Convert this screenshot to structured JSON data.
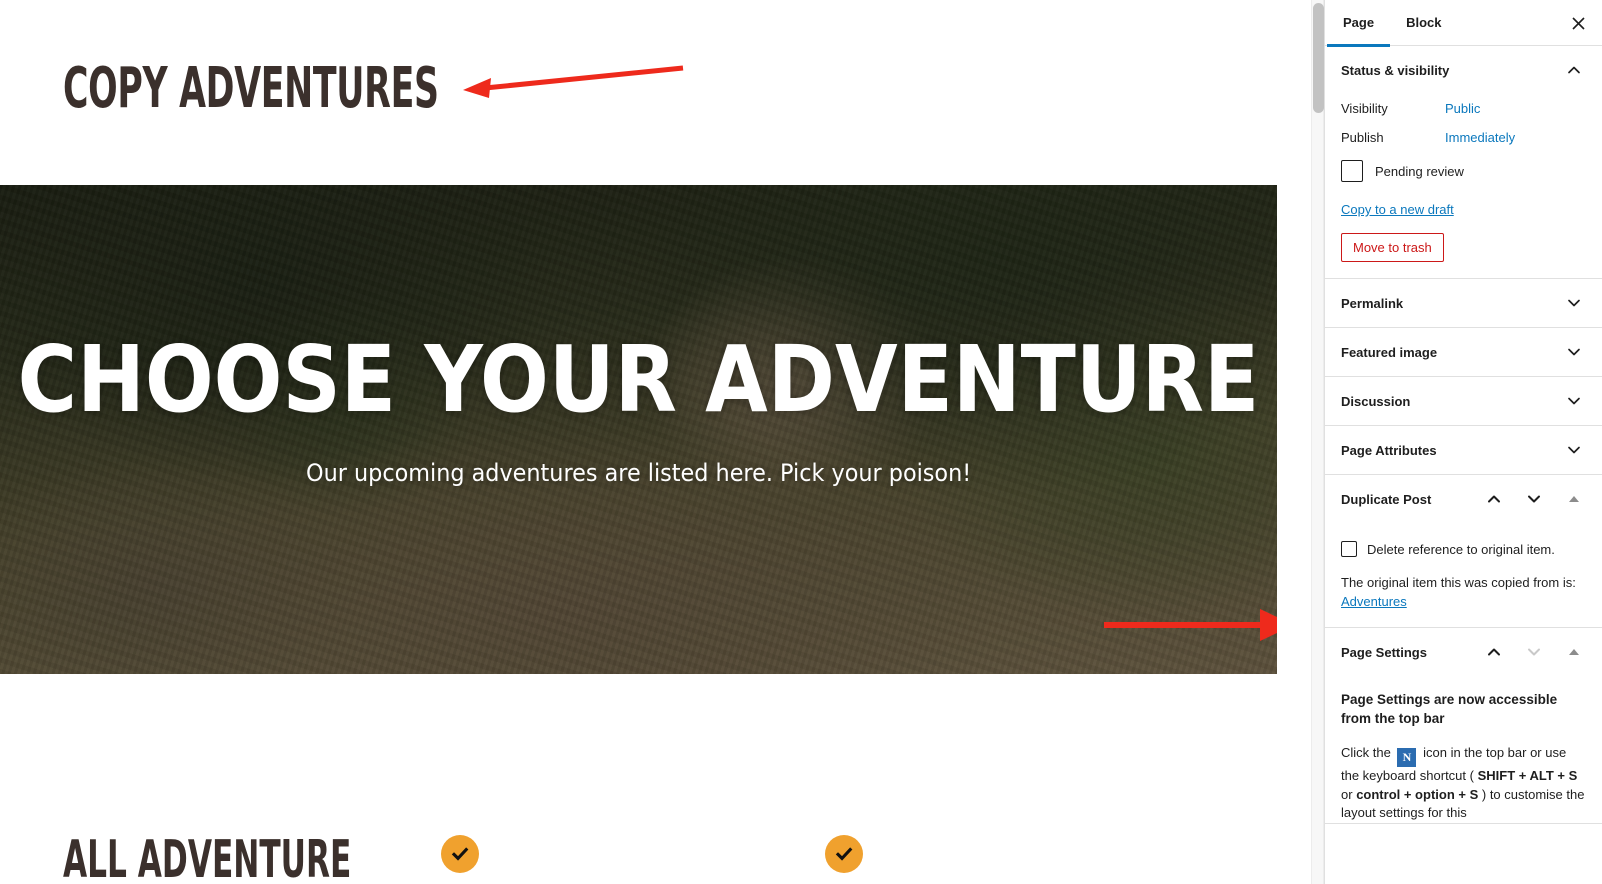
{
  "theme": {
    "accent_orange": "#f0a12e",
    "link_blue": "#0b78bd",
    "danger_red": "#cc1818",
    "annotation_red": "#ee2a1c",
    "title_brown": "#3b302c"
  },
  "editor": {
    "post_title": "COPY ADVENTURES",
    "hero": {
      "heading": "CHOOSE YOUR ADVENTURE",
      "subheading": "Our upcoming adventures are listed here. Pick your poison!"
    },
    "bottom_heading": "ALL ADVENTURE",
    "check_badges": [
      {
        "name": "check-badge-1",
        "glyph": "check"
      },
      {
        "name": "check-badge-2",
        "glyph": "check"
      }
    ],
    "annotations": [
      {
        "name": "arrow-to-title",
        "points_to": "post_title"
      },
      {
        "name": "arrow-to-duplicate-post-note",
        "points_to": "duplicate_post.original_note"
      }
    ]
  },
  "sidebar": {
    "tabs": [
      {
        "label": "Page",
        "active": true
      },
      {
        "label": "Block",
        "active": false
      }
    ],
    "close_label": "✕",
    "status_visibility": {
      "title": "Status & visibility",
      "expanded": true,
      "visibility_label": "Visibility",
      "visibility_value": "Public",
      "publish_label": "Publish",
      "publish_value": "Immediately",
      "pending_review_label": "Pending review",
      "pending_review_checked": false,
      "copy_draft_label": "Copy to a new draft",
      "move_to_trash_label": "Move to trash"
    },
    "collapsed_panels": [
      {
        "title": "Permalink"
      },
      {
        "title": "Featured image"
      },
      {
        "title": "Discussion"
      },
      {
        "title": "Page Attributes"
      }
    ],
    "duplicate_post": {
      "title": "Duplicate Post",
      "delete_reference_label": "Delete reference to original item.",
      "delete_reference_checked": false,
      "original_note_prefix": "The original item this was copied from is:",
      "original_link_label": "Adventures"
    },
    "page_settings": {
      "title": "Page Settings",
      "heading": "Page Settings are now accessible from the top bar",
      "body_part_1": "Click the",
      "icon_glyph": "N",
      "body_part_2": "icon in the top bar or use the keyboard shortcut (",
      "shortcut_1": "SHIFT + ALT + S",
      "body_part_3": "or",
      "shortcut_2": "control + option + S",
      "body_part_4": ") to customise the layout settings for this"
    }
  }
}
